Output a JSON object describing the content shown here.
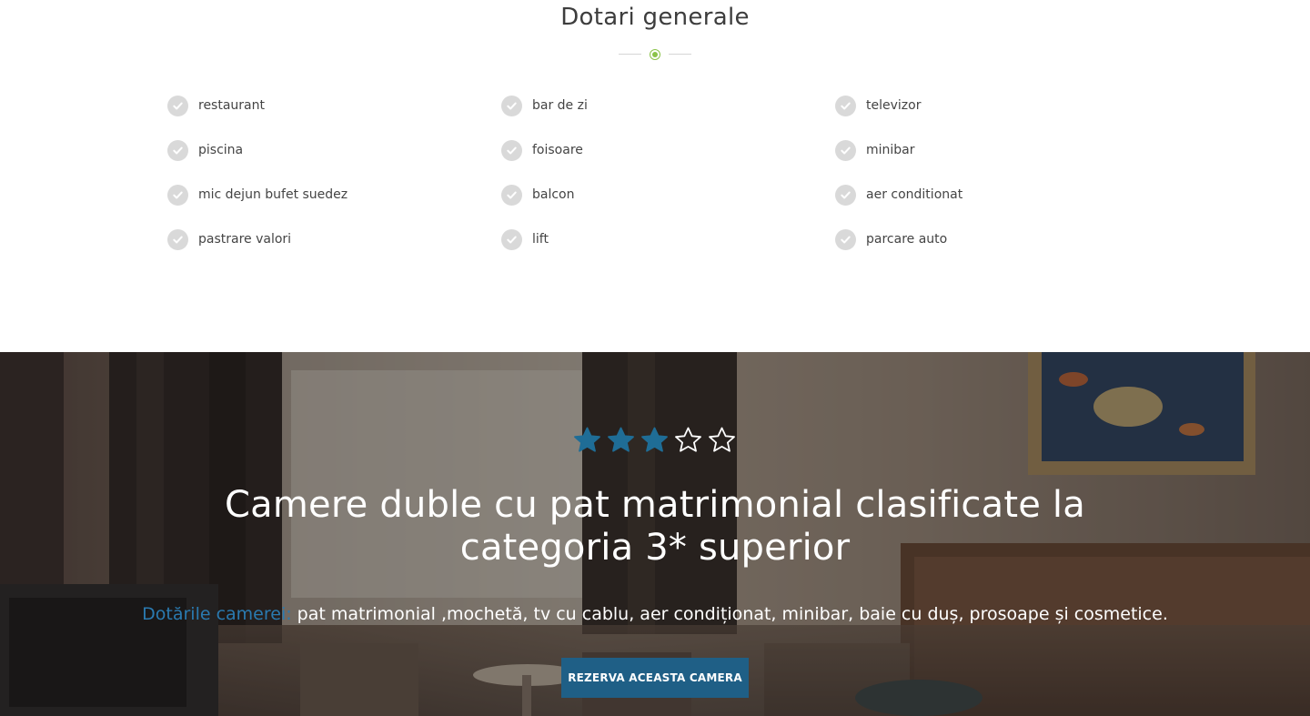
{
  "amenities": {
    "title": "Dotari generale",
    "items": [
      "restaurant",
      "bar de zi",
      "televizor",
      "piscina",
      "foisoare",
      "minibar",
      "mic dejun bufet suedez",
      "balcon",
      "aer conditionat",
      "pastrare valori",
      "lift",
      "parcare auto"
    ],
    "check_icon": "check-circle-icon",
    "accent_color": "#8bc34a"
  },
  "room": {
    "rating": 3,
    "rating_max": 5,
    "star_color": "#1f6d96",
    "title": "Camere duble cu pat matrimonial clasificate la categoria 3* superior",
    "desc_label": "Dotările camerei:",
    "desc_text": "pat matrimonial ,mochetă, tv cu cablu, aer condiționat, minibar, baie cu duș, prosoape și cosmetice.",
    "cta_label": "REZERVA ACEASTA CAMERA",
    "cta_color": "#1f5f86"
  }
}
